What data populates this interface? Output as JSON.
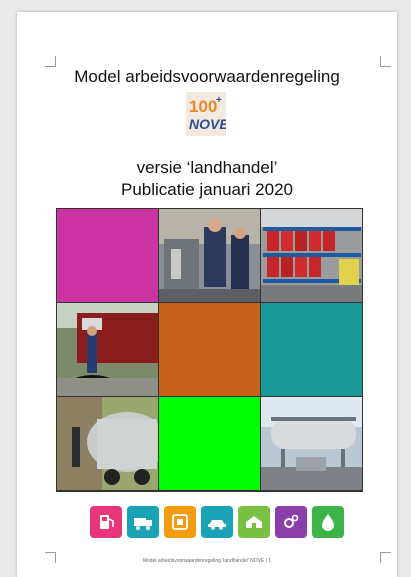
{
  "document": {
    "title": "Model arbeidsvoorwaardenregeling",
    "logo_text_top": "100",
    "logo_plus": "+",
    "logo_text_bottom": "NOVE",
    "subtitle": "versie ‘landhandel’",
    "publication": "Publicatie januari 2020",
    "footer": "Model arbeidsvoorwaardenregeling 'landhandel' NOVE  |  1"
  },
  "colors": {
    "magenta_tile": "#cc33a3",
    "orange_tile": "#c4621c",
    "teal_tile": "#1a9898",
    "green_tile": "#00ff00",
    "logo_blue": "#2b4f8c",
    "logo_orange": "#e8892a"
  },
  "icons": [
    {
      "name": "fuel-pump-icon",
      "color": "#e8367b"
    },
    {
      "name": "truck-icon",
      "color": "#1aa3b5"
    },
    {
      "name": "tank-icon",
      "color": "#f39c12"
    },
    {
      "name": "car-icon",
      "color": "#1aa3b5"
    },
    {
      "name": "farm-icon",
      "color": "#7ac043"
    },
    {
      "name": "gears-icon",
      "color": "#8b3fa8"
    },
    {
      "name": "drop-icon",
      "color": "#3db34a"
    }
  ]
}
